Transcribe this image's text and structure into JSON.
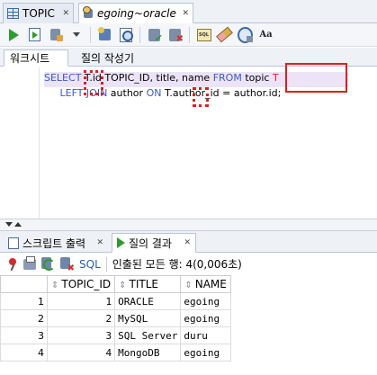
{
  "document_tabs": [
    {
      "label": "TOPIC",
      "active": false
    },
    {
      "label": "egoing~oracle",
      "active": true
    }
  ],
  "toolbar": {
    "font_button_label": "Aa"
  },
  "sub_tabs": [
    {
      "label": "워크시트",
      "active": true
    },
    {
      "label": "질의 작성기",
      "active": false
    }
  ],
  "editor": {
    "line1": {
      "select_kw": "SELECT",
      "part1": " T.id TOPIC_ID, title, name ",
      "from_kw": "FROM",
      "part2": " topic ",
      "alias": "T"
    },
    "line2": {
      "indent": "   ",
      "join_kw": "LEFT JOIN",
      "part1": " author ",
      "on_kw": "ON",
      "part2": " T.author_id = author.id;"
    }
  },
  "output_tabs": [
    {
      "label": "스크립트 출력",
      "active": false
    },
    {
      "label": "질의 결과",
      "active": true
    }
  ],
  "results_toolbar": {
    "sql_label": "SQL",
    "status": "인출된 모든 행: 4(0,006초)"
  },
  "results": {
    "columns": [
      "TOPIC_ID",
      "TITLE",
      "NAME"
    ],
    "rows": [
      {
        "rownum": "1",
        "topic_id": "1",
        "title": "ORACLE",
        "name": "egoing"
      },
      {
        "rownum": "2",
        "topic_id": "2",
        "title": "MySQL",
        "name": "egoing"
      },
      {
        "rownum": "3",
        "topic_id": "3",
        "title": "SQL Server",
        "name": "duru"
      },
      {
        "rownum": "4",
        "topic_id": "4",
        "title": "MongoDB",
        "name": "egoing"
      }
    ]
  },
  "colors": {
    "keyword": "#3d59c8",
    "highlight_box": "#e01e1e",
    "current_line": "#ece4f6"
  },
  "icons": {
    "toolbar": [
      "run-statement-icon",
      "run-script-icon",
      "autotrace-icon",
      "dropdown-caret-icon",
      "compile-icon",
      "find-icon",
      "commit-icon",
      "rollback-icon",
      "sql-tuning-icon",
      "clear-icon",
      "explain-plan-icon",
      "font-icon"
    ],
    "results": [
      "pin-icon",
      "print-icon",
      "refresh-icon",
      "cancel-icon"
    ]
  }
}
